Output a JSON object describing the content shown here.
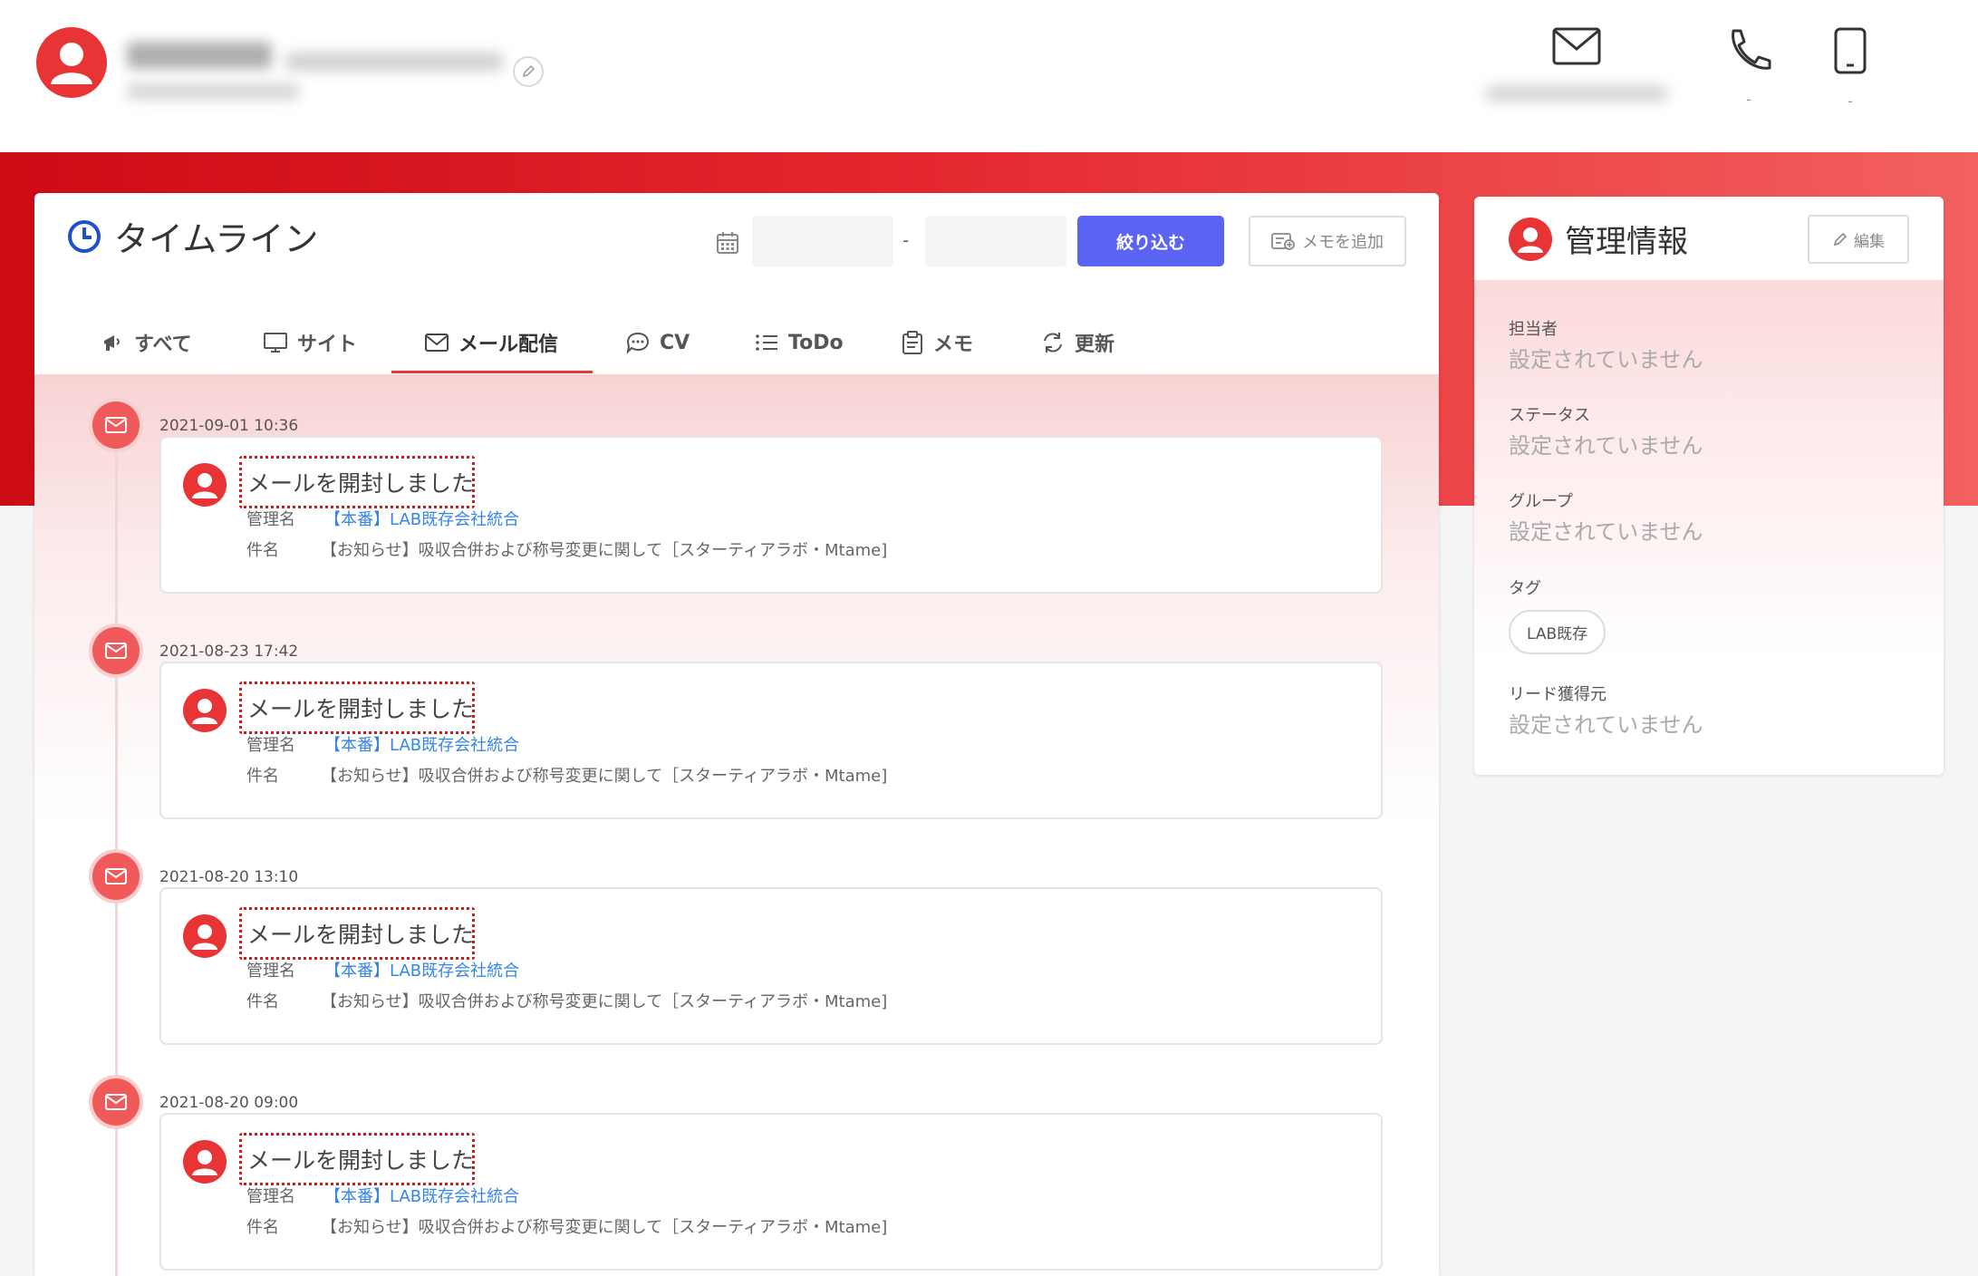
{
  "header": {
    "contacts": [
      {
        "icon": "mail-icon",
        "label": ""
      },
      {
        "icon": "phone-icon",
        "label": "-"
      },
      {
        "icon": "mobile-icon",
        "label": "-"
      }
    ]
  },
  "timeline": {
    "title": "タイムライン",
    "date_sep": "-",
    "filter_label": "絞り込む",
    "add_memo_label": "メモを追加",
    "tabs": [
      {
        "label": "すべて",
        "icon": "bullhorn-icon"
      },
      {
        "label": "サイト",
        "icon": "monitor-icon"
      },
      {
        "label": "メール配信",
        "icon": "mail-icon"
      },
      {
        "label": "CV",
        "icon": "chat-icon"
      },
      {
        "label": "ToDo",
        "icon": "list-icon"
      },
      {
        "label": "メモ",
        "icon": "clipboard-icon"
      },
      {
        "label": "更新",
        "icon": "refresh-icon"
      }
    ],
    "active_tab": "メール配信",
    "entries": [
      {
        "time": "2021-09-01 10:36",
        "title": "メールを開封しました",
        "mgmt_label": "管理名",
        "mgmt_value": "【本番】LAB既存会社統合",
        "subject_label": "件名",
        "subject_value": "【お知らせ】吸収合併および称号変更に関して［スターティアラボ・Mtame]"
      },
      {
        "time": "2021-08-23 17:42",
        "title": "メールを開封しました",
        "mgmt_label": "管理名",
        "mgmt_value": "【本番】LAB既存会社統合",
        "subject_label": "件名",
        "subject_value": "【お知らせ】吸収合併および称号変更に関して［スターティアラボ・Mtame]"
      },
      {
        "time": "2021-08-20 13:10",
        "title": "メールを開封しました",
        "mgmt_label": "管理名",
        "mgmt_value": "【本番】LAB既存会社統合",
        "subject_label": "件名",
        "subject_value": "【お知らせ】吸収合併および称号変更に関して［スターティアラボ・Mtame]"
      },
      {
        "time": "2021-08-20 09:00",
        "title": "メールを開封しました",
        "mgmt_label": "管理名",
        "mgmt_value": "【本番】LAB既存会社統合",
        "subject_label": "件名",
        "subject_value": "【お知らせ】吸収合併および称号変更に関して［スターティアラボ・Mtame]"
      }
    ]
  },
  "management": {
    "title": "管理情報",
    "edit_label": "編集",
    "fields": [
      {
        "label": "担当者",
        "value": "設定されていません"
      },
      {
        "label": "ステータス",
        "value": "設定されていません"
      },
      {
        "label": "グループ",
        "value": "設定されていません"
      },
      {
        "label": "タグ",
        "tag": "LAB既存"
      },
      {
        "label": "リード獲得元",
        "value": "設定されていません"
      }
    ]
  },
  "colors": {
    "brand_red": "#e4262d",
    "accent_blue": "#5a63f2",
    "link_blue": "#3585e6",
    "highlight_dotted": "#d11a1a"
  }
}
